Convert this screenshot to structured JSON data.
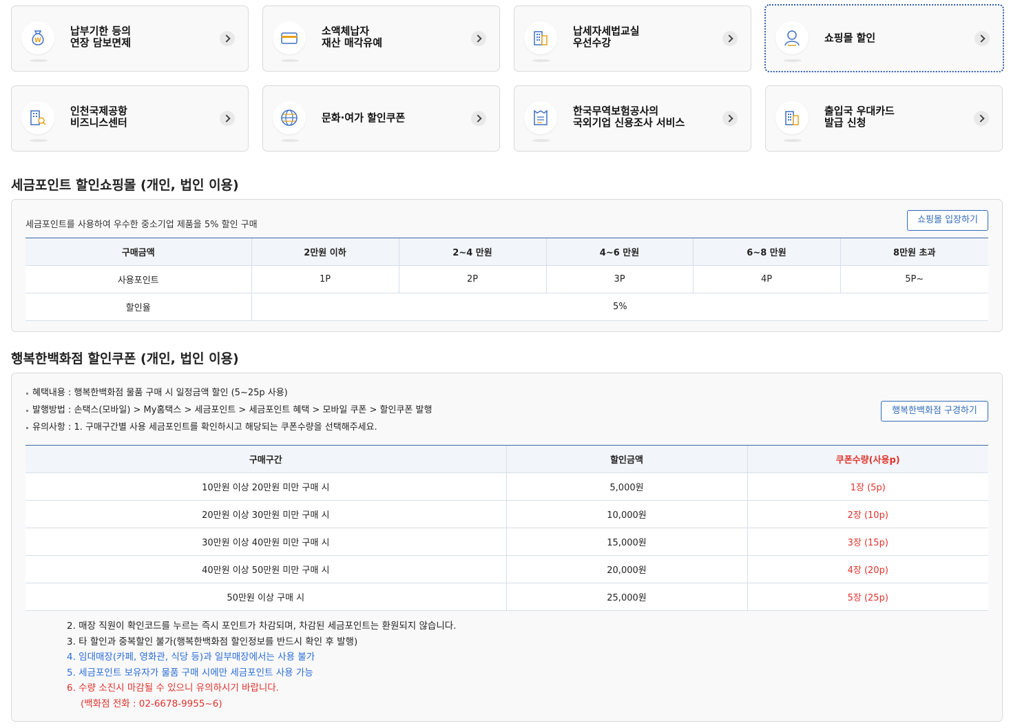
{
  "cards": [
    {
      "label": "납부기한 등의\n연장 담보면제",
      "icon": "money-bag-icon"
    },
    {
      "label": "소액체납자\n재산 매각유예",
      "icon": "credit-card-icon"
    },
    {
      "label": "납세자세법교실\n우선수강",
      "icon": "building-icon"
    },
    {
      "label": "쇼핑몰 할인",
      "icon": "user-icon"
    },
    {
      "label": "인천국제공항\n비즈니스센터",
      "icon": "building-search-icon"
    },
    {
      "label": "문화·여가 할인쿠폰",
      "icon": "globe-icon"
    },
    {
      "label": "한국무역보험공사의\n국외기업 신용조사 서비스",
      "icon": "document-icon"
    },
    {
      "label": "출입국 우대카드\n발급 신청",
      "icon": "building-icon"
    }
  ],
  "shopping": {
    "title": "세금포인트 할인쇼핑몰 (개인, 법인 이용)",
    "description": "세금포인트를 사용하여 우수한 중소기업 제품을 5% 할인 구매",
    "button": "쇼핑몰 입장하기",
    "headers": [
      "구매금액",
      "2만원 이하",
      "2~4 만원",
      "4~6 만원",
      "6~8 만원",
      "8만원 초과"
    ],
    "points_row": {
      "label": "사용포인트",
      "values": [
        "1P",
        "2P",
        "3P",
        "4P",
        "5P~"
      ]
    },
    "rate_row": {
      "label": "할인율",
      "value": "5%"
    }
  },
  "department": {
    "title": "행복한백화점 할인쿠폰 (개인, 법인 이용)",
    "bullets": [
      "혜택내용 : 행복한백화점 물품 구매 시 일정금액 할인 (5~25p 사용)",
      "발행방법 : 손택스(모바일) > My홈택스 > 세금포인트 > 세금포인트 혜택 > 모바일 쿠폰 > 할인쿠폰 발행",
      "유의사항 : 1. 구매구간별 사용 세금포인트를 확인하시고 해당되는 쿠폰수량을 선택해주세요."
    ],
    "button": "행복한백화점 구경하기",
    "headers": [
      "구매구간",
      "할인금액",
      "쿠폰수량(사용p)"
    ],
    "rows": [
      [
        "10만원 이상 20만원 미만 구매 시",
        "5,000원",
        "1장 (5p)"
      ],
      [
        "20만원 이상 30만원 미만 구매 시",
        "10,000원",
        "2장 (10p)"
      ],
      [
        "30만원 이상 40만원 미만 구매 시",
        "15,000원",
        "3장 (15p)"
      ],
      [
        "40만원 이상 50만원 미만 구매 시",
        "20,000원",
        "4장 (20p)"
      ],
      [
        "50만원 이상 구매 시",
        "25,000원",
        "5장 (25p)"
      ]
    ],
    "notes": [
      {
        "text": "2. 매장 직원이 확인코드를 누르는 즉시 포인트가 차감되며, 차감된 세금포인트는 환원되지 않습니다.",
        "color": "#222222"
      },
      {
        "text": "3. 타 할인과 중복할인 불가(행복한백화점 할인정보를 반드시 확인 후 발행)",
        "color": "#222222"
      },
      {
        "text": "4. 임대매장(카페, 영화관, 식당 등)과 일부매장에서는 사용 불가",
        "color": "#2a6dd6"
      },
      {
        "text": "5. 세금포인트 보유자가 물품 구매 시에만 세금포인트 사용 가능",
        "color": "#2a6dd6"
      },
      {
        "text": "6. 수량 소진시 마감될 수 있으니 유의하시기 바랍니다.",
        "color": "#e0312b"
      },
      {
        "text": "(백화점 전화 : 02-6678-9955~6)",
        "color": "#e0312b"
      }
    ]
  }
}
